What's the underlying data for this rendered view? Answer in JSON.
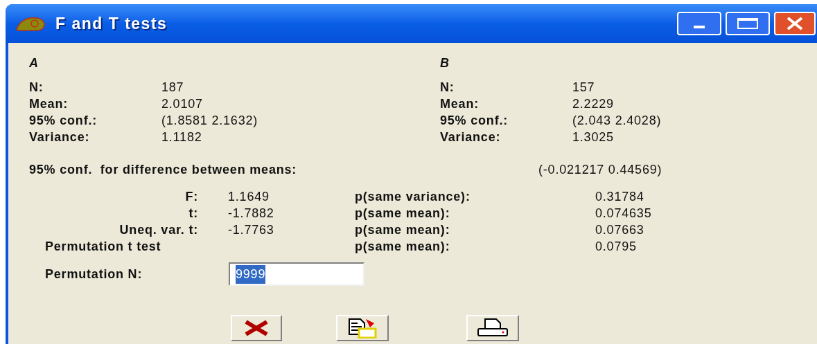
{
  "window": {
    "title": "F and T tests"
  },
  "groups": [
    {
      "name": "A",
      "rows": [
        {
          "label": "N:",
          "value": "187"
        },
        {
          "label": "Mean:",
          "value": "2.0107"
        },
        {
          "label": "95% conf.:",
          "value": "(1.8581 2.1632)"
        },
        {
          "label": "Variance:",
          "value": "1.1182"
        }
      ]
    },
    {
      "name": "B",
      "rows": [
        {
          "label": "N:",
          "value": "157"
        },
        {
          "label": "Mean:",
          "value": "2.2229"
        },
        {
          "label": "95% conf.:",
          "value": "(2.043 2.4028)"
        },
        {
          "label": "Variance:",
          "value": "1.3025"
        }
      ]
    }
  ],
  "difference": {
    "label": "95% conf.  for difference between means:",
    "value": "(-0.021217 0.44569)"
  },
  "tests": [
    {
      "label": "F:",
      "value": "1.1649",
      "p_label": "p(same variance):",
      "p_value": "0.31784"
    },
    {
      "label": "t:",
      "value": "-1.7882",
      "p_label": "p(same mean):",
      "p_value": "0.074635"
    },
    {
      "label": "Uneq. var. t:",
      "value": "-1.7763",
      "p_label": "p(same mean):",
      "p_value": "0.07663"
    },
    {
      "label": "Permutation t test",
      "p_label": "p(same mean):",
      "p_value": "0.0795"
    }
  ],
  "permutation_n": {
    "label": "Permutation N:",
    "value": "9999",
    "text_selected": true
  }
}
